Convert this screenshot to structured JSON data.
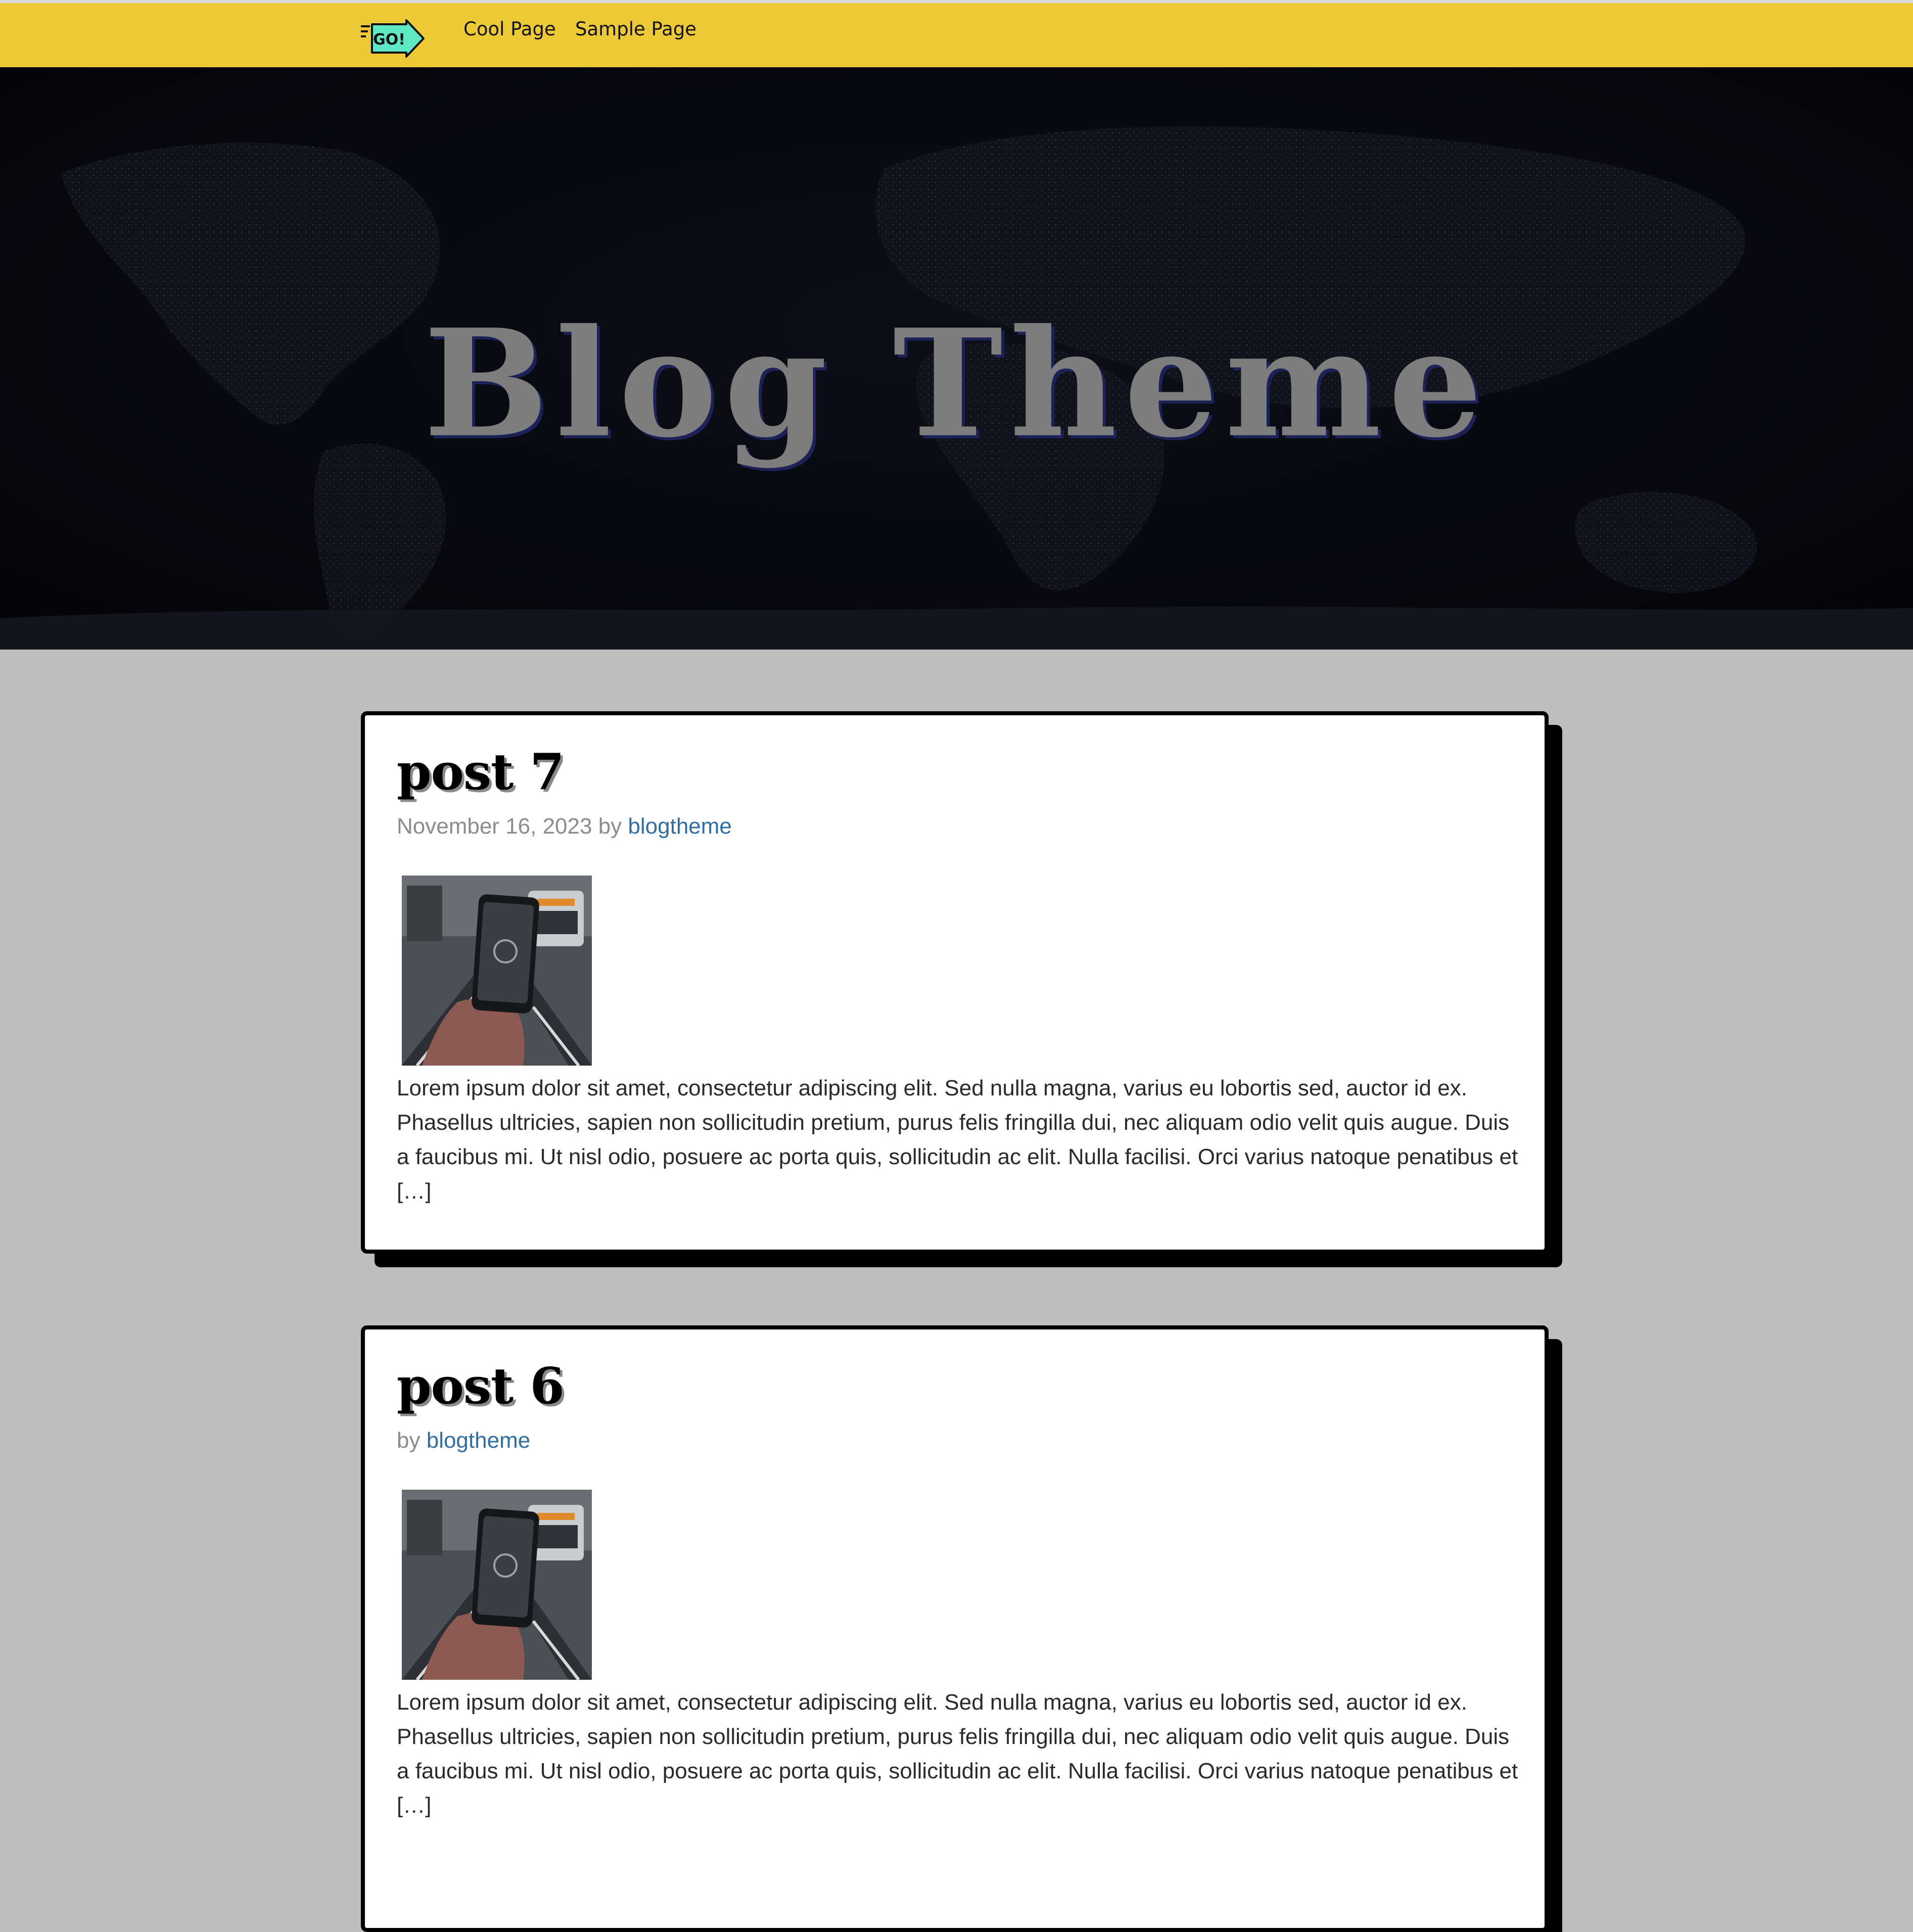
{
  "nav": {
    "logo_text": "GO!",
    "links": [
      {
        "label": "Cool Page"
      },
      {
        "label": "Sample Page"
      }
    ]
  },
  "hero": {
    "title": "Blog Theme"
  },
  "posts": [
    {
      "title": "post 7",
      "date": "November 16, 2023",
      "by": "by",
      "author": "blogtheme",
      "excerpt": "Lorem ipsum dolor sit amet, consectetur adipiscing elit. Sed nulla magna, varius eu lobortis sed, auctor id ex. Phasellus ultricies, sapien non sollicitudin pretium, purus felis fringilla dui, nec aliquam odio velit quis augue. Duis a faucibus mi. Ut nisl odio, posuere ac porta quis, sollicitudin ac elit. Nulla facilisi. Orci varius natoque penatibus et […]"
    },
    {
      "title": "post 6",
      "date": "",
      "by": "by",
      "author": "blogtheme",
      "excerpt": "Lorem ipsum dolor sit amet, consectetur adipiscing elit. Sed nulla magna, varius eu lobortis sed, auctor id ex. Phasellus ultricies, sapien non sollicitudin pretium, purus felis fringilla dui, nec aliquam odio velit quis augue. Duis a faucibus mi. Ut nisl odio, posuere ac porta quis, sollicitudin ac elit. Nulla facilisi. Orci varius natoque penatibus et […]"
    }
  ],
  "colors": {
    "nav_background": "#ecc935",
    "page_background": "#bebebe",
    "link": "#2f6ea6",
    "logo_accent": "#5ee8c3"
  }
}
